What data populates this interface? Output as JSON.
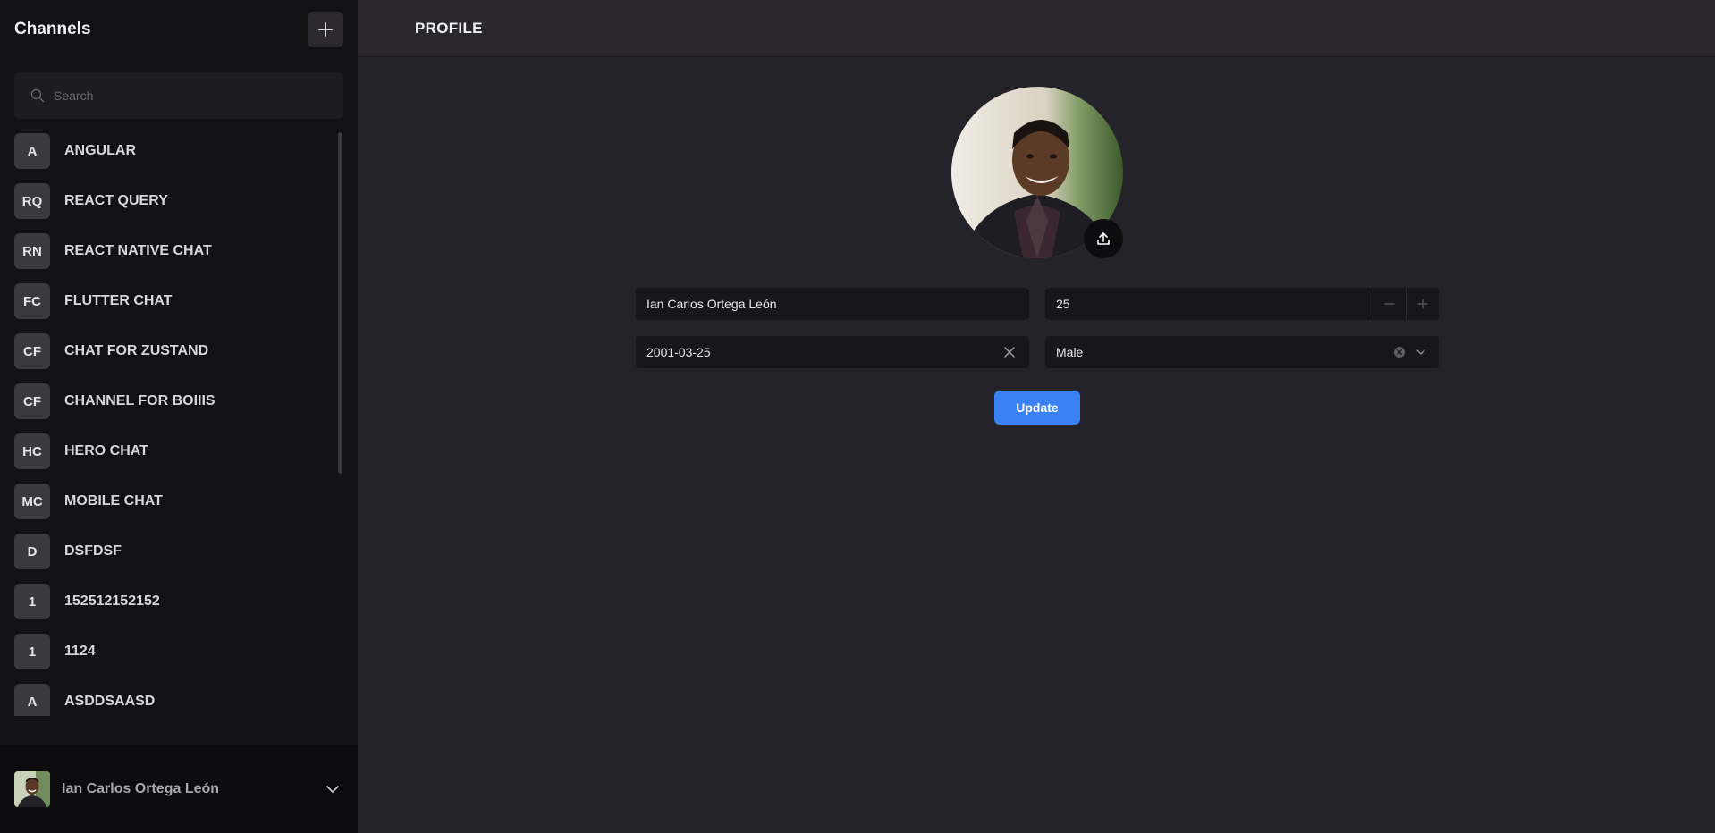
{
  "sidebar": {
    "title": "Channels",
    "add_icon": "plus-icon",
    "search_placeholder": "Search",
    "search_icon": "search-icon",
    "channels": [
      {
        "initials": "A",
        "name": "ANGULAR"
      },
      {
        "initials": "RQ",
        "name": "REACT QUERY"
      },
      {
        "initials": "RN",
        "name": "REACT NATIVE CHAT"
      },
      {
        "initials": "FC",
        "name": "FLUTTER CHAT"
      },
      {
        "initials": "CF",
        "name": "CHAT FOR ZUSTAND"
      },
      {
        "initials": "CF",
        "name": "CHANNEL FOR BOIIIS"
      },
      {
        "initials": "HC",
        "name": "HERO CHAT"
      },
      {
        "initials": "MC",
        "name": "MOBILE CHAT"
      },
      {
        "initials": "D",
        "name": "DSFDSF"
      },
      {
        "initials": "1",
        "name": "152512152152"
      },
      {
        "initials": "1",
        "name": "1124"
      },
      {
        "initials": "A",
        "name": "ASDDSAASD"
      }
    ],
    "user": {
      "name": "Ian Carlos Ortega León",
      "menu_icon": "chevron-down-icon"
    }
  },
  "header": {
    "title": "PROFILE"
  },
  "profile": {
    "upload_icon": "upload-icon",
    "name_value": "Ian Carlos Ortega León",
    "age_value": "25",
    "dob_value": "2001-03-25",
    "gender_value": "Male",
    "update_label": "Update"
  },
  "colors": {
    "sidebar_bg": "#121114",
    "main_bg": "#25232a",
    "accent": "#3b82f6"
  }
}
